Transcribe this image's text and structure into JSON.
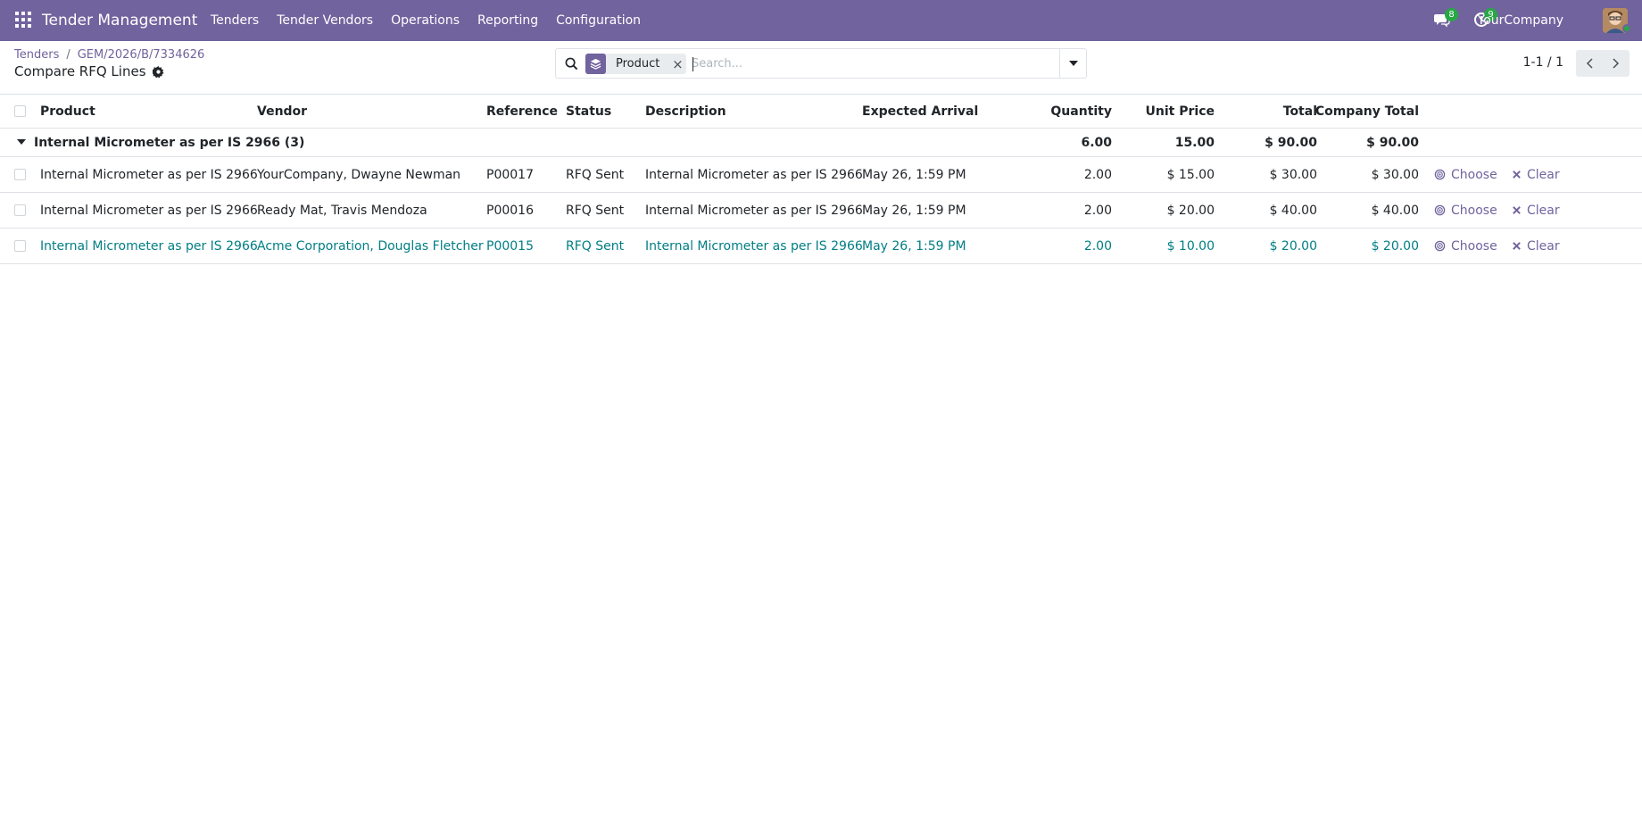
{
  "navbar": {
    "app_title": "Tender Management",
    "menu": [
      "Tenders",
      "Tender Vendors",
      "Operations",
      "Reporting",
      "Configuration"
    ],
    "messages_count": "8",
    "activities_count": "9",
    "company": "YourCompany",
    "color": "#71639e"
  },
  "breadcrumb": {
    "items": [
      "Tenders",
      "GEM/2026/B/7334626"
    ],
    "separator": "/",
    "current": "Compare RFQ Lines"
  },
  "search": {
    "facet_label": "Product",
    "placeholder": "Search...",
    "value": ""
  },
  "pager": {
    "value": "1-1 / 1"
  },
  "table": {
    "headers": {
      "product": "Product",
      "vendor": "Vendor",
      "reference": "Reference",
      "status": "Status",
      "description": "Description",
      "expected_arrival": "Expected Arrival",
      "quantity": "Quantity",
      "unit_price": "Unit Price",
      "total": "Total",
      "company_total": "Company Total"
    },
    "group": {
      "label": "Internal Micrometer as per IS 2966 (3)",
      "quantity": "6.00",
      "unit_price": "15.00",
      "total": "$ 90.00",
      "company_total": "$ 90.00"
    },
    "rows": [
      {
        "product": "Internal Micrometer as per IS 2966",
        "vendor": "YourCompany, Dwayne Newman",
        "reference": "P00017",
        "status": "RFQ Sent",
        "description": "Internal Micrometer as per IS 2966",
        "expected_arrival": "May 26, 1:59 PM",
        "quantity": "2.00",
        "unit_price": "$ 15.00",
        "total": "$ 30.00",
        "company_total": "$ 30.00",
        "choose": "Choose",
        "clear": "Clear"
      },
      {
        "product": "Internal Micrometer as per IS 2966",
        "vendor": "Ready Mat, Travis Mendoza",
        "reference": "P00016",
        "status": "RFQ Sent",
        "description": "Internal Micrometer as per IS 2966",
        "expected_arrival": "May 26, 1:59 PM",
        "quantity": "2.00",
        "unit_price": "$ 20.00",
        "total": "$ 40.00",
        "company_total": "$ 40.00",
        "choose": "Choose",
        "clear": "Clear"
      },
      {
        "product": "Internal Micrometer as per IS 2966",
        "vendor": "Acme Corporation, Douglas Fletcher",
        "reference": "P00015",
        "status": "RFQ Sent",
        "description": "Internal Micrometer as per IS 2966",
        "expected_arrival": "May 26, 1:59 PM",
        "quantity": "2.00",
        "unit_price": "$ 10.00",
        "total": "$ 20.00",
        "company_total": "$ 20.00",
        "choose": "Choose",
        "clear": "Clear"
      }
    ],
    "highlight_color": "#017e84"
  }
}
